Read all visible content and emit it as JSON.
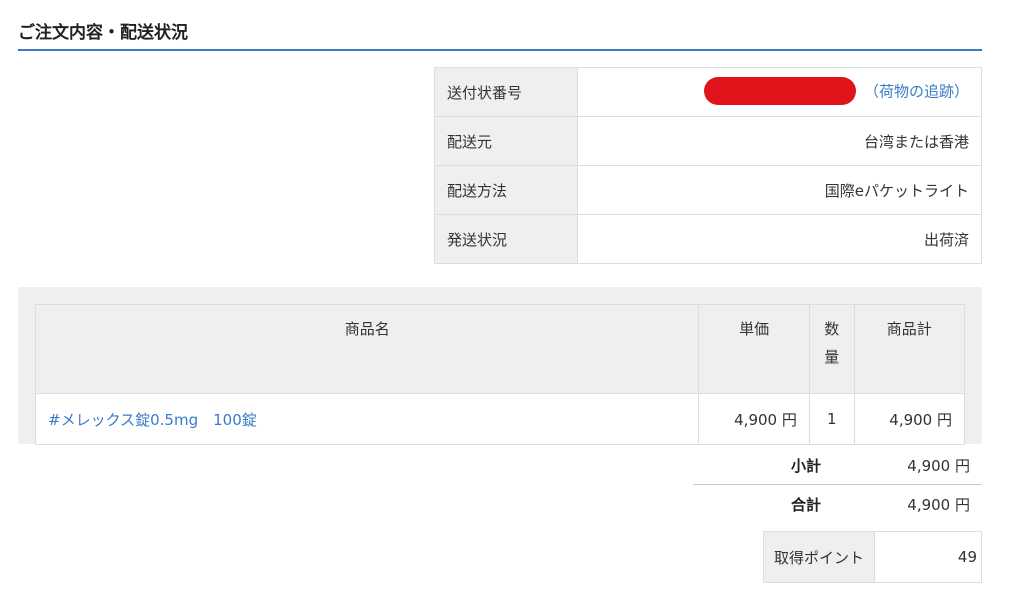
{
  "section_title": "ご注文内容・配送状況",
  "shipping": {
    "tracking_label": "送付状番号",
    "tracking_link": "（荷物の追跡）",
    "origin_label": "配送元",
    "origin_value": "台湾または香港",
    "method_label": "配送方法",
    "method_value": "国際eパケットライト",
    "status_label": "発送状況",
    "status_value": "出荷済"
  },
  "products": {
    "headers": {
      "name": "商品名",
      "price": "単価",
      "qty_line1": "数",
      "qty_line2": "量",
      "total": "商品計"
    },
    "rows": [
      {
        "name": "#メレックス錠0.5mg　100錠",
        "price": "4,900 円",
        "qty": "1",
        "total": "4,900 円"
      }
    ]
  },
  "totals": {
    "subtotal_label": "小計",
    "subtotal_value": "4,900 円",
    "total_label": "合計",
    "total_value": "4,900 円"
  },
  "points": {
    "label": "取得ポイント",
    "value": "49"
  },
  "colors": {
    "accent": "#3a7bc8",
    "redaction": "#e0141b",
    "header_bg": "#efefef"
  }
}
